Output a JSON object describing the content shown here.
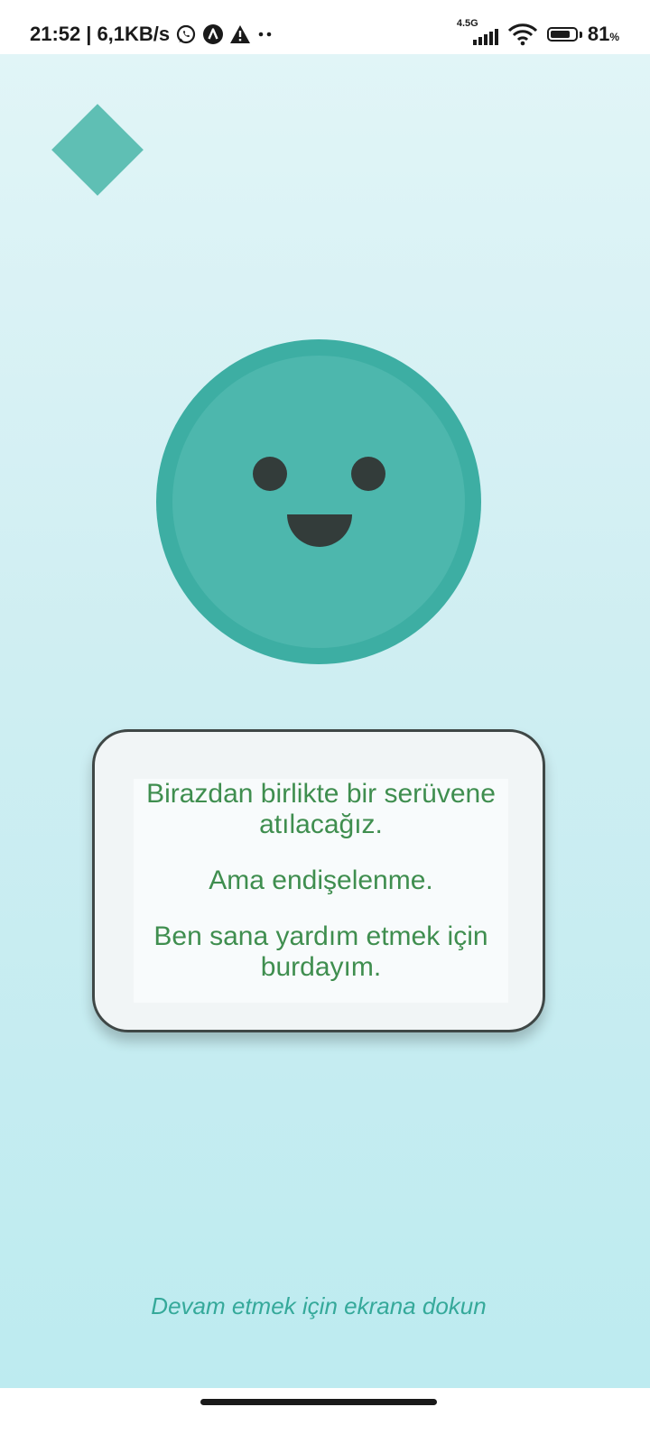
{
  "status_bar": {
    "time": "21:52",
    "separator": "|",
    "net_speed": "6,1KB/s",
    "notification_icons": [
      "whatsapp-icon",
      "a-letter-icon",
      "warning-icon",
      "more-dots-icon"
    ],
    "network_label": "4.5G",
    "battery_level": 81,
    "battery_text": "81",
    "battery_unit": "%"
  },
  "main": {
    "message_lines": [
      "Birazdan birlikte bir serüvene atılacağız.",
      "Ama endişelenme.",
      "Ben sana yardım etmek için burdayım."
    ],
    "continue_hint": "Devam etmek için ekrana dokun"
  },
  "colors": {
    "accent": "#4db7ad",
    "face_ring": "#3daea3",
    "diamond": "#5fbfb4",
    "message_text": "#3f8e4f",
    "hint_text": "#35a99a",
    "background_top": "#e1f5f7",
    "background_bottom": "#bdebf0"
  }
}
